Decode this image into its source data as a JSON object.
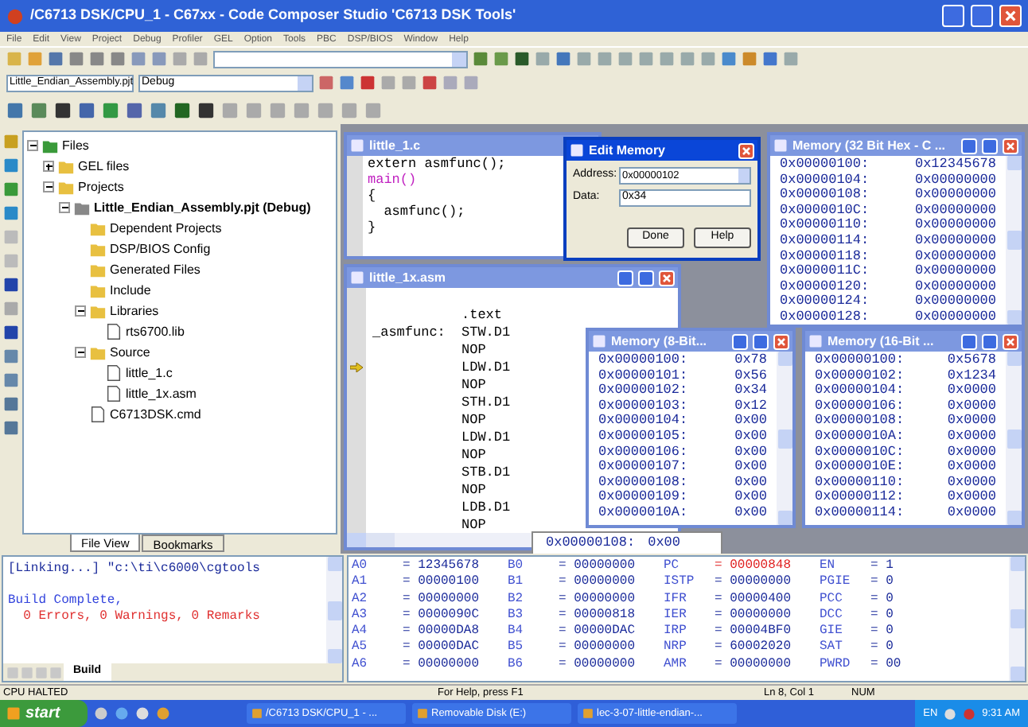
{
  "window": {
    "title": "/C6713 DSK/CPU_1 - C67xx - Code Composer Studio 'C6713 DSK Tools'"
  },
  "menu": [
    "File",
    "Edit",
    "View",
    "Project",
    "Debug",
    "Profiler",
    "GEL",
    "Option",
    "Tools",
    "PBC",
    "DSP/BIOS",
    "Window",
    "Help"
  ],
  "toolbar": {
    "project_select": "Little_Endian_Assembly.pjt",
    "config_select": "Debug"
  },
  "file_tree": [
    {
      "label": "Files",
      "kind": "root",
      "expanded": true,
      "children": [
        {
          "label": "GEL files",
          "kind": "folder",
          "expanded": false
        },
        {
          "label": "Projects",
          "kind": "folder",
          "expanded": true,
          "children": [
            {
              "label": "Little_Endian_Assembly.pjt (Debug)",
              "kind": "project",
              "expanded": true,
              "children": [
                {
                  "label": "Dependent Projects",
                  "kind": "folder"
                },
                {
                  "label": "DSP/BIOS Config",
                  "kind": "folder"
                },
                {
                  "label": "Generated Files",
                  "kind": "folder"
                },
                {
                  "label": "Include",
                  "kind": "folder"
                },
                {
                  "label": "Libraries",
                  "kind": "folder",
                  "expanded": true,
                  "children": [
                    {
                      "label": "rts6700.lib",
                      "kind": "file"
                    }
                  ]
                },
                {
                  "label": "Source",
                  "kind": "folder",
                  "expanded": true,
                  "children": [
                    {
                      "label": "little_1.c",
                      "kind": "file"
                    },
                    {
                      "label": "little_1x.asm",
                      "kind": "file"
                    }
                  ]
                },
                {
                  "label": "C6713DSK.cmd",
                  "kind": "file"
                }
              ]
            }
          ]
        }
      ]
    }
  ],
  "panel_tabs": [
    {
      "label": "File View",
      "selected": true
    },
    {
      "label": "Bookmarks",
      "selected": false
    }
  ],
  "editor_c": {
    "title": "little_1.c",
    "lines": [
      {
        "text": "extern asmfunc();",
        "kind": "code"
      },
      {
        "text": "main()",
        "kind": "keyword"
      },
      {
        "text": "{",
        "kind": "code"
      },
      {
        "text": "  asmfunc();",
        "kind": "code"
      },
      {
        "text": "}",
        "kind": "code"
      }
    ]
  },
  "edit_memory": {
    "title": "Edit Memory",
    "address_label": "Address:",
    "address": "0x00000102",
    "data_label": "Data:",
    "data": "0x34",
    "buttons": [
      "Done",
      "Help"
    ]
  },
  "editor_asm": {
    "title": "little_1x.asm",
    "lines": [
      {
        "code": ".text",
        "current": false
      },
      {
        "label": "_asmfunc:",
        "code": "STW.D1",
        "current": false
      },
      {
        "code": "NOP",
        "current": false
      },
      {
        "code": "LDW.D1",
        "current": true
      },
      {
        "code": "NOP",
        "current": false
      },
      {
        "code": "STH.D1",
        "current": false
      },
      {
        "code": "NOP",
        "current": false
      },
      {
        "code": "LDW.D1",
        "current": false
      },
      {
        "code": "NOP",
        "current": false
      },
      {
        "code": "STB.D1",
        "current": false
      },
      {
        "code": "NOP",
        "current": false
      },
      {
        "code": "LDB.D1",
        "current": false
      },
      {
        "code": "NOP",
        "current": false
      }
    ]
  },
  "memory_windows": [
    {
      "title": "Memory (32 Bit Hex - C ...",
      "rows": [
        {
          "address": "0x00000100:",
          "value": "0x12345678"
        },
        {
          "address": "0x00000104:",
          "value": "0x00000000"
        },
        {
          "address": "0x00000108:",
          "value": "0x00000000"
        },
        {
          "address": "0x0000010C:",
          "value": "0x00000000"
        },
        {
          "address": "0x00000110:",
          "value": "0x00000000"
        },
        {
          "address": "0x00000114:",
          "value": "0x00000000"
        },
        {
          "address": "0x00000118:",
          "value": "0x00000000"
        },
        {
          "address": "0x0000011C:",
          "value": "0x00000000"
        },
        {
          "address": "0x00000120:",
          "value": "0x00000000"
        },
        {
          "address": "0x00000124:",
          "value": "0x00000000"
        },
        {
          "address": "0x00000128:",
          "value": "0x00000000"
        }
      ]
    },
    {
      "title": "Memory (8-Bit...",
      "rows": [
        {
          "address": "0x00000100:",
          "value": "0x78"
        },
        {
          "address": "0x00000101:",
          "value": "0x56"
        },
        {
          "address": "0x00000102:",
          "value": "0x34"
        },
        {
          "address": "0x00000103:",
          "value": "0x12"
        },
        {
          "address": "0x00000104:",
          "value": "0x00"
        },
        {
          "address": "0x00000105:",
          "value": "0x00"
        },
        {
          "address": "0x00000106:",
          "value": "0x00"
        },
        {
          "address": "0x00000107:",
          "value": "0x00"
        },
        {
          "address": "0x00000108:",
          "value": "0x00"
        },
        {
          "address": "0x00000109:",
          "value": "0x00"
        },
        {
          "address": "0x0000010A:",
          "value": "0x00"
        }
      ]
    },
    {
      "title": "Memory (16-Bit ...",
      "rows": [
        {
          "address": "0x00000100:",
          "value": "0x5678"
        },
        {
          "address": "0x00000102:",
          "value": "0x1234"
        },
        {
          "address": "0x00000104:",
          "value": "0x0000"
        },
        {
          "address": "0x00000106:",
          "value": "0x0000"
        },
        {
          "address": "0x00000108:",
          "value": "0x0000"
        },
        {
          "address": "0x0000010A:",
          "value": "0x0000"
        },
        {
          "address": "0x0000010C:",
          "value": "0x0000"
        },
        {
          "address": "0x0000010E:",
          "value": "0x0000"
        },
        {
          "address": "0x00000110:",
          "value": "0x0000"
        },
        {
          "address": "0x00000112:",
          "value": "0x0000"
        },
        {
          "address": "0x00000114:",
          "value": "0x0000"
        }
      ]
    }
  ],
  "background_memory": {
    "address": "0x00000108:",
    "value": "0x00"
  },
  "build_output": {
    "lines": [
      {
        "text": "[Linking...] \"c:\\ti\\c6000\\cgtools",
        "kind": "command"
      },
      {
        "text": "Build Complete,",
        "kind": "status"
      },
      {
        "text": "  0 Errors, 0 Warnings, 0 Remarks",
        "kind": "result"
      }
    ],
    "tabs": [
      {
        "label": "Build",
        "selected": true
      }
    ]
  },
  "registers": [
    [
      {
        "name": "A0",
        "value": "= 12345678",
        "changed": false
      },
      {
        "name": "B0",
        "value": "= 00000000",
        "changed": false
      },
      {
        "name": "PC",
        "value": "= 00000848",
        "changed": true
      },
      {
        "name": "EN",
        "value": "= 1",
        "changed": false
      }
    ],
    [
      {
        "name": "A1",
        "value": "= 00000100",
        "changed": false
      },
      {
        "name": "B1",
        "value": "= 00000000",
        "changed": false
      },
      {
        "name": "ISTP",
        "value": "= 00000000",
        "changed": false
      },
      {
        "name": "PGIE",
        "value": "= 0",
        "changed": false
      }
    ],
    [
      {
        "name": "A2",
        "value": "= 00000000",
        "changed": false
      },
      {
        "name": "B2",
        "value": "= 00000000",
        "changed": false
      },
      {
        "name": "IFR",
        "value": "= 00000400",
        "changed": false
      },
      {
        "name": "PCC",
        "value": "= 0",
        "changed": false
      }
    ],
    [
      {
        "name": "A3",
        "value": "= 0000090C",
        "changed": false
      },
      {
        "name": "B3",
        "value": "= 00000818",
        "changed": false
      },
      {
        "name": "IER",
        "value": "= 00000000",
        "changed": false
      },
      {
        "name": "DCC",
        "value": "= 0",
        "changed": false
      }
    ],
    [
      {
        "name": "A4",
        "value": "= 00000DA8",
        "changed": false
      },
      {
        "name": "B4",
        "value": "= 00000DAC",
        "changed": false
      },
      {
        "name": "IRP",
        "value": "= 00004BF0",
        "changed": false
      },
      {
        "name": "GIE",
        "value": "= 0",
        "changed": false
      }
    ],
    [
      {
        "name": "A5",
        "value": "= 00000DAC",
        "changed": false
      },
      {
        "name": "B5",
        "value": "= 00000000",
        "changed": false
      },
      {
        "name": "NRP",
        "value": "= 60002020",
        "changed": false
      },
      {
        "name": "SAT",
        "value": "= 0",
        "changed": false
      }
    ],
    [
      {
        "name": "A6",
        "value": "= 00000000",
        "changed": false
      },
      {
        "name": "B6",
        "value": "= 00000000",
        "changed": false
      },
      {
        "name": "AMR",
        "value": "= 00000000",
        "changed": false
      },
      {
        "name": "PWRD",
        "value": "= 00",
        "changed": false
      }
    ]
  ],
  "status_bar": {
    "state": "CPU HALTED",
    "help": "For Help, press F1",
    "position": "Ln 8, Col 1",
    "num": "NUM"
  },
  "taskbar": {
    "start": "start",
    "tasks": [
      "/C6713 DSK/CPU_1 - ...",
      "Removable Disk (E:)",
      "lec-3-07-little-endian-..."
    ],
    "language": "EN",
    "clock": "9:31 AM"
  }
}
